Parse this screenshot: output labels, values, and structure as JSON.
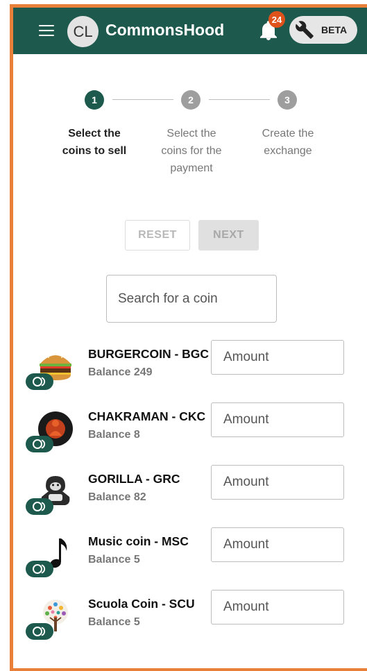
{
  "header": {
    "avatar_initials": "CL",
    "title": "CommonsHood",
    "notification_count": "24",
    "beta_label": "BETA",
    "colors": {
      "appbar": "#1d5a4d",
      "badge": "#e0521b",
      "frame": "#e8803a"
    }
  },
  "stepper": {
    "steps": [
      {
        "number": "1",
        "label_line1": "Select the",
        "label_line2": "coins to sell",
        "label_line3": "",
        "active": true
      },
      {
        "number": "2",
        "label_line1": "Select the",
        "label_line2": "coins for the",
        "label_line3": "payment",
        "active": false
      },
      {
        "number": "3",
        "label_line1": "Create the",
        "label_line2": "exchange",
        "label_line3": "",
        "active": false
      }
    ]
  },
  "actions": {
    "reset_label": "RESET",
    "next_label": "NEXT"
  },
  "search": {
    "placeholder": "Search for a coin"
  },
  "coins": [
    {
      "name": "BURGERCOIN - BGC",
      "balance": "Balance 249",
      "amount_placeholder": "Amount",
      "icon": "burger-icon"
    },
    {
      "name": "CHAKRAMAN - CKC",
      "balance": "Balance 8",
      "amount_placeholder": "Amount",
      "icon": "chakraman-icon"
    },
    {
      "name": "GORILLA - GRC",
      "balance": "Balance 82",
      "amount_placeholder": "Amount",
      "icon": "gorilla-icon"
    },
    {
      "name": "Music coin - MSC",
      "balance": "Balance 5",
      "amount_placeholder": "Amount",
      "icon": "music-note-icon"
    },
    {
      "name": "Scuola Coin - SCU",
      "balance": "Balance 5",
      "amount_placeholder": "Amount",
      "icon": "tree-icon"
    }
  ]
}
